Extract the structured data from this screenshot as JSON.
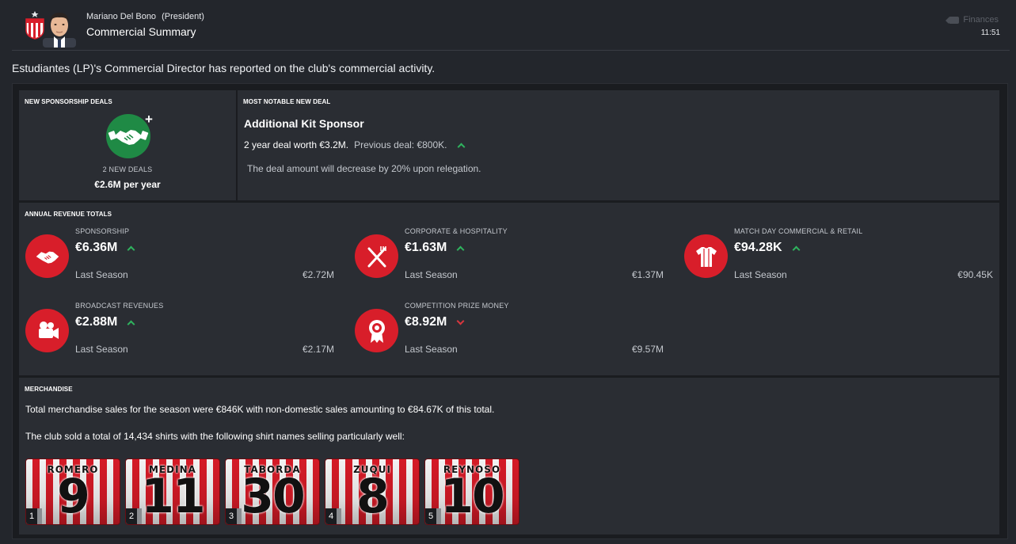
{
  "header": {
    "sender_name": "Mariano Del Bono",
    "sender_role": "(President)",
    "subject": "Commercial Summary",
    "category": "Finances",
    "time": "11:51"
  },
  "intro": "Estudiantes (LP)'s Commercial Director has reported on the club's commercial activity.",
  "new_sponsorship": {
    "title": "NEW SPONSORSHIP DEALS",
    "count": "2 NEW DEALS",
    "per_year": "€2.6M per year"
  },
  "notable": {
    "title": "MOST NOTABLE NEW DEAL",
    "name": "Additional Kit Sponsor",
    "deal": "2 year deal worth €3.2M.",
    "previous": "Previous deal: €800K.",
    "note": "The deal amount will decrease by 20% upon relegation."
  },
  "annual": {
    "title": "ANNUAL REVENUE TOTALS",
    "last_season_label": "Last Season",
    "items": [
      {
        "label": "SPONSORSHIP",
        "value": "€6.36M",
        "trend": "up",
        "last": "€2.72M",
        "icon": "handshake-icon"
      },
      {
        "label": "CORPORATE & HOSPITALITY",
        "value": "€1.63M",
        "trend": "up",
        "last": "€1.37M",
        "icon": "cutlery-icon"
      },
      {
        "label": "MATCH DAY COMMERCIAL & RETAIL",
        "value": "€94.28K",
        "trend": "up",
        "last": "€90.45K",
        "icon": "shirt-icon"
      },
      {
        "label": "BROADCAST REVENUES",
        "value": "€2.88M",
        "trend": "up",
        "last": "€2.17M",
        "icon": "camera-icon"
      },
      {
        "label": "COMPETITION PRIZE MONEY",
        "value": "€8.92M",
        "trend": "down",
        "last": "€9.57M",
        "icon": "rosette-icon"
      }
    ]
  },
  "merchandise": {
    "title": "MERCHANDISE",
    "line1": "Total merchandise sales for the season were €846K with non-domestic sales amounting to €84.67K of this total.",
    "line2": "The club sold a total of 14,434 shirts with the following shirt names selling particularly well:",
    "shirts": [
      {
        "rank": "1",
        "name": "ROMERO",
        "number": "9"
      },
      {
        "rank": "2",
        "name": "MEDINA",
        "number": "11"
      },
      {
        "rank": "3",
        "name": "TABORDA",
        "number": "30"
      },
      {
        "rank": "4",
        "name": "ZUQUI",
        "number": "8"
      },
      {
        "rank": "5",
        "name": "REYNOSO",
        "number": "10"
      }
    ]
  },
  "colors": {
    "accent_red": "#d81e2a",
    "deal_green": "#1f8a45",
    "trend_up": "#2fb35e",
    "trend_down": "#d9363e"
  }
}
